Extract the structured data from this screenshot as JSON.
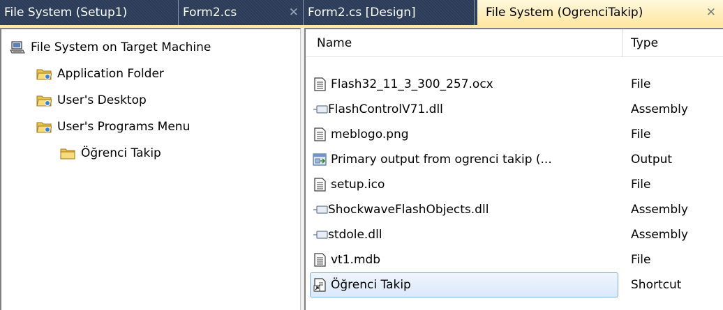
{
  "tabs": [
    {
      "label": "File System (Setup1)",
      "close": ""
    },
    {
      "label": "Form2.cs",
      "close": "✕"
    },
    {
      "label": "Form2.cs [Design]",
      "close": ""
    },
    {
      "label": "File System (OgrenciTakip)",
      "close": "✕"
    }
  ],
  "tree": {
    "root": "File System on Target Machine",
    "items": [
      {
        "label": "Application Folder"
      },
      {
        "label": "User's Desktop"
      },
      {
        "label": "User's Programs Menu"
      },
      {
        "label": "Öğrenci Takip"
      }
    ]
  },
  "list": {
    "columns": {
      "name": "Name",
      "type": "Type"
    },
    "rows": [
      {
        "name": "Flash32_11_3_300_257.ocx",
        "type": "File",
        "icon": "file-icon"
      },
      {
        "name": "FlashControlV71.dll",
        "type": "Assembly",
        "icon": "assembly-icon"
      },
      {
        "name": "meblogo.png",
        "type": "File",
        "icon": "file-icon"
      },
      {
        "name": "Primary output from ogrenci takip (...",
        "type": "Output",
        "icon": "output-icon"
      },
      {
        "name": "setup.ico",
        "type": "File",
        "icon": "file-icon"
      },
      {
        "name": "ShockwaveFlashObjects.dll",
        "type": "Assembly",
        "icon": "assembly-icon"
      },
      {
        "name": "stdole.dll",
        "type": "Assembly",
        "icon": "assembly-icon"
      },
      {
        "name": "vt1.mdb",
        "type": "File",
        "icon": "file-icon"
      },
      {
        "name": "Öğrenci Takip",
        "type": "Shortcut",
        "icon": "shortcut-icon",
        "selected": true
      }
    ]
  },
  "colors": {
    "tab_strip_bg": "#2b3c59",
    "active_tab_bg": "#ffe8a6",
    "selection_border": "#84acdd"
  }
}
